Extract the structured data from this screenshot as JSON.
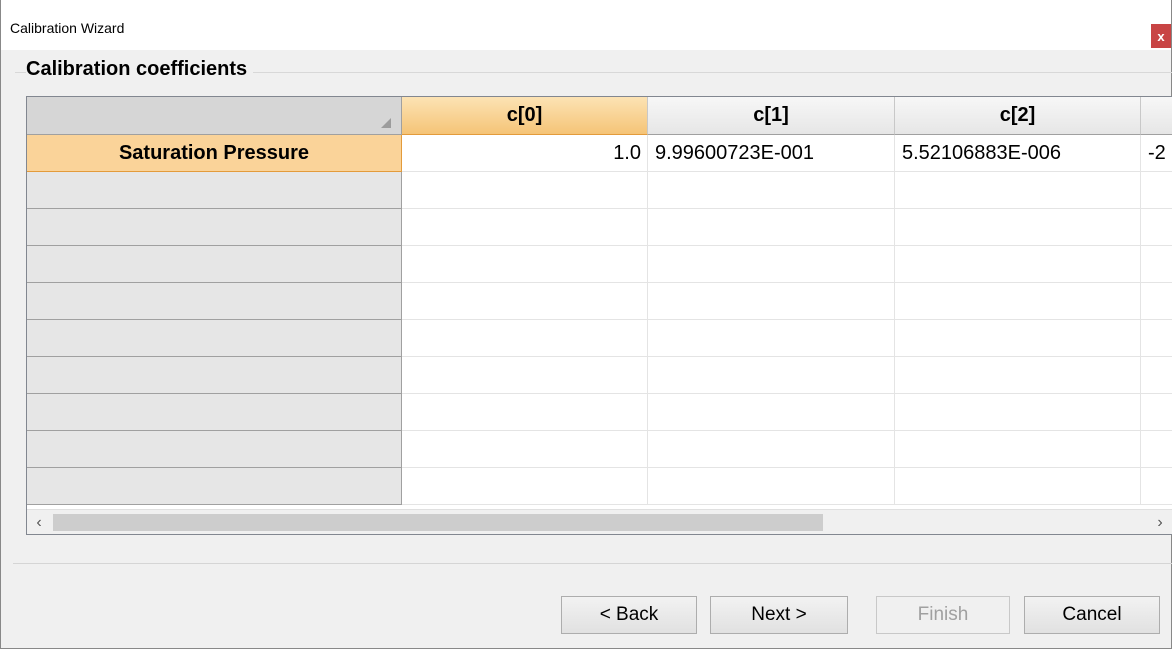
{
  "window": {
    "title": "Calibration Wizard",
    "close_label": "x"
  },
  "group": {
    "title": "Calibration coefficients"
  },
  "grid": {
    "columns": [
      "c[0]",
      "c[1]",
      "c[2]"
    ],
    "rows": [
      {
        "label": "Saturation Pressure",
        "values": [
          "1.0",
          "9.99600723E-001",
          "5.52106883E-006",
          "-2"
        ]
      }
    ],
    "empty_row_count": 9
  },
  "scrollbar": {
    "left_arrow": "‹",
    "right_arrow": "›"
  },
  "buttons": {
    "back": "< Back",
    "next": "Next >",
    "finish": "Finish",
    "cancel": "Cancel"
  },
  "colors": {
    "selection": "#f5c477",
    "close": "#c84444"
  }
}
